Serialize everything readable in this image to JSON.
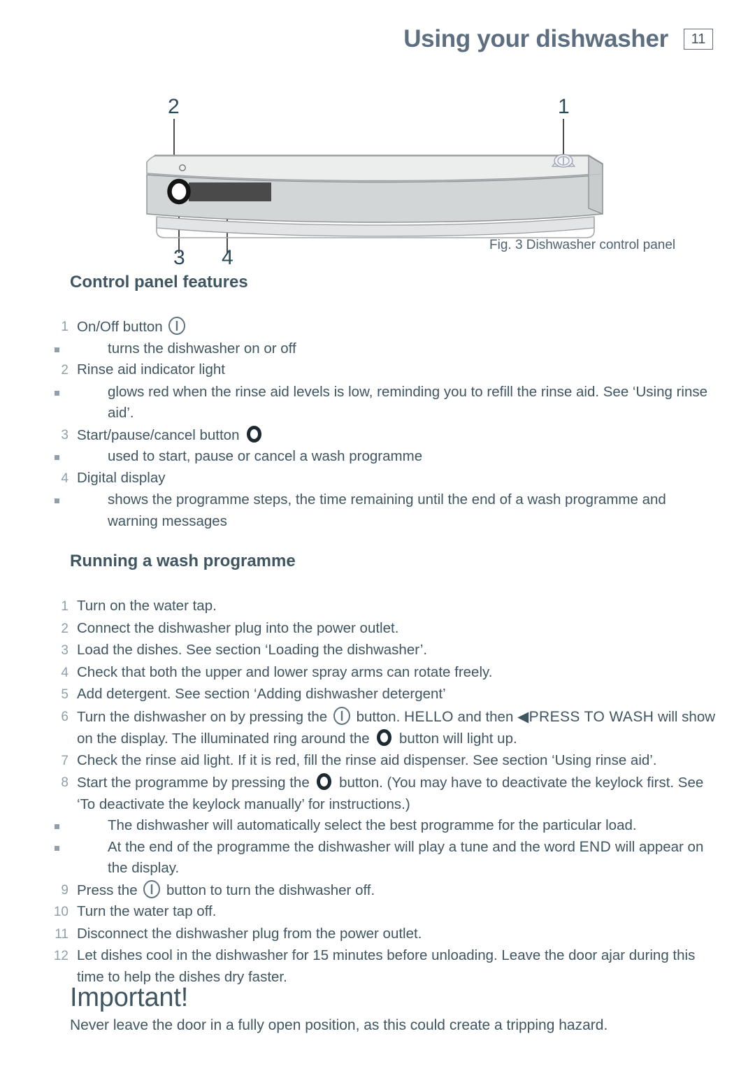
{
  "header": {
    "title": "Using your dishwasher",
    "page_number": "11"
  },
  "figure": {
    "caption": "Fig. 3 Dishwasher control panel",
    "callouts": [
      {
        "label": "1",
        "target": "on-off-button"
      },
      {
        "label": "2",
        "target": "rinse-aid-indicator-light"
      },
      {
        "label": "3",
        "target": "start-pause-cancel-button"
      },
      {
        "label": "4",
        "target": "digital-display"
      }
    ],
    "colors": {
      "panel_top": "#e8e8ea",
      "panel_front": "#d2d5d6",
      "panel_outline": "#8a8f93",
      "display": "#4a4a4a",
      "button_ring": "#1c1c1c"
    }
  },
  "control_panel_features": {
    "heading": "Control panel features",
    "items": [
      {
        "num": "1",
        "text": "On/Off button ",
        "icon": "power-icon",
        "subs": [
          "turns the dishwasher on or off"
        ]
      },
      {
        "num": "2",
        "text": "Rinse aid indicator light",
        "icon": "",
        "subs": [
          "glows red when the rinse aid levels is low, reminding you to refill the rinse aid. See ‘Using rinse aid’."
        ]
      },
      {
        "num": "3",
        "text": "Start/pause/cancel button ",
        "icon": "ring-icon",
        "subs": [
          "used to start, pause or cancel a wash programme"
        ]
      },
      {
        "num": "4",
        "text": "Digital display",
        "icon": "",
        "subs": [
          "shows the programme steps, the time remaining until the end of a wash programme and warning messages"
        ]
      }
    ]
  },
  "running_a_wash_programme": {
    "heading": "Running a wash programme",
    "steps": [
      {
        "num": "1",
        "text": "Turn on the water tap."
      },
      {
        "num": "2",
        "text": "Connect the dishwasher plug into the power outlet."
      },
      {
        "num": "3",
        "text": "Load the dishes. See section ‘Loading the dishwasher’."
      },
      {
        "num": "4",
        "text": "Check that both the upper and lower spray arms can rotate freely."
      },
      {
        "num": "5",
        "text": "Add detergent. See section ‘Adding dishwasher detergent’"
      },
      {
        "num": "6",
        "parts": [
          {
            "t": "text",
            "v": "Turn the dishwasher on by pressing the "
          },
          {
            "t": "icon",
            "v": "power-icon"
          },
          {
            "t": "text",
            "v": " button. "
          },
          {
            "t": "lcd",
            "v": "HELLO"
          },
          {
            "t": "text",
            "v": "  and then "
          },
          {
            "t": "lcd",
            "v": "◀PRESS TO WASH"
          },
          {
            "t": "text",
            "v": " will show on the display. The illuminated ring around the "
          },
          {
            "t": "icon",
            "v": "ring-icon"
          },
          {
            "t": "text",
            "v": " button will light up."
          }
        ]
      },
      {
        "num": "7",
        "text": "Check the rinse aid light. If it is red, fill the rinse aid dispenser. See section ‘Using rinse aid’."
      },
      {
        "num": "8",
        "parts": [
          {
            "t": "text",
            "v": "Start the programme by pressing the "
          },
          {
            "t": "icon",
            "v": "ring-icon"
          },
          {
            "t": "text",
            "v": " button. (You may have to deactivate the keylock first. See ‘To deactivate the keylock manually’ for instructions.)"
          }
        ],
        "subs": [
          {
            "parts": [
              {
                "t": "text",
                "v": "The dishwasher will automatically select the best programme for the particular load."
              }
            ]
          },
          {
            "parts": [
              {
                "t": "text",
                "v": "At the end of the programme the dishwasher will play a tune and the word "
              },
              {
                "t": "lcd",
                "v": "END"
              },
              {
                "t": "text",
                "v": "  will appear on the display."
              }
            ]
          }
        ]
      },
      {
        "num": "9",
        "parts": [
          {
            "t": "text",
            "v": "Press the "
          },
          {
            "t": "icon",
            "v": "power-icon"
          },
          {
            "t": "text",
            "v": " button to turn the dishwasher off."
          }
        ]
      },
      {
        "num": "10",
        "text": "Turn the water tap off."
      },
      {
        "num": "11",
        "text": "Disconnect the dishwasher plug from the power outlet."
      },
      {
        "num": "12",
        "text": "Let dishes cool in the dishwasher for 15 minutes before unloading. Leave the door ajar during this time to help the dishes dry faster."
      }
    ]
  },
  "important": {
    "title": "Important!",
    "body": "Never leave the door in a fully open position, as this could create a tripping hazard."
  }
}
